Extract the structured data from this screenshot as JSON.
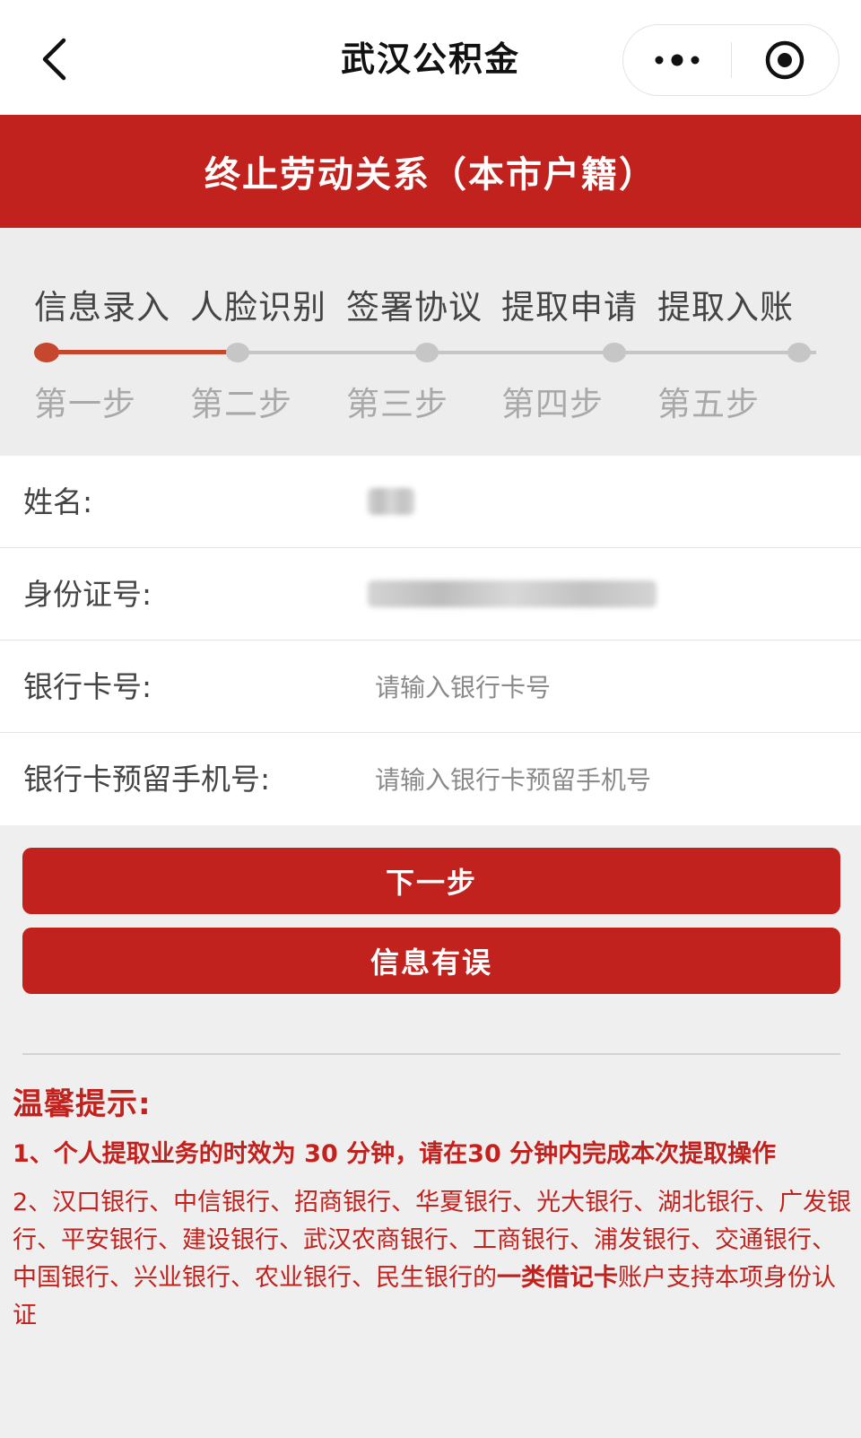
{
  "navbar": {
    "title": "武汉公积金"
  },
  "header": {
    "title": "终止劳动关系（本市户籍）"
  },
  "steps": [
    {
      "name": "信息录入",
      "sub": "第一步",
      "active": true
    },
    {
      "name": "人脸识别",
      "sub": "第二步",
      "active": false
    },
    {
      "name": "签署协议",
      "sub": "第三步",
      "active": false
    },
    {
      "name": "提取申请",
      "sub": "第四步",
      "active": false
    },
    {
      "name": "提取入账",
      "sub": "第五步",
      "active": false
    }
  ],
  "form": {
    "name_label": "姓名:",
    "id_label": "身份证号:",
    "bank_card_label": "银行卡号:",
    "bank_card_placeholder": "请输入银行卡号",
    "phone_label": "银行卡预留手机号:",
    "phone_placeholder": "请输入银行卡预留手机号"
  },
  "buttons": {
    "next": "下一步",
    "info_error": "信息有误"
  },
  "tips": {
    "title": "温馨提示:",
    "tip1": "1、个人提取业务的时效为 30 分钟，请在30 分钟内完成本次提取操作",
    "tip2_prefix": "2、汉口银行、中信银行、招商银行、华夏银行、光大银行、湖北银行、广发银行、平安银行、建设银行、武汉农商银行、工商银行、浦发银行、交通银行、中国银行、兴业银行、农业银行、民生银行的",
    "tip2_bold": "一类借记卡",
    "tip2_suffix": "账户支持本项身份认证"
  },
  "colors": {
    "brand_red": "#c1221e",
    "step_active": "#c5472d",
    "step_inactive": "#c6c6c6"
  }
}
